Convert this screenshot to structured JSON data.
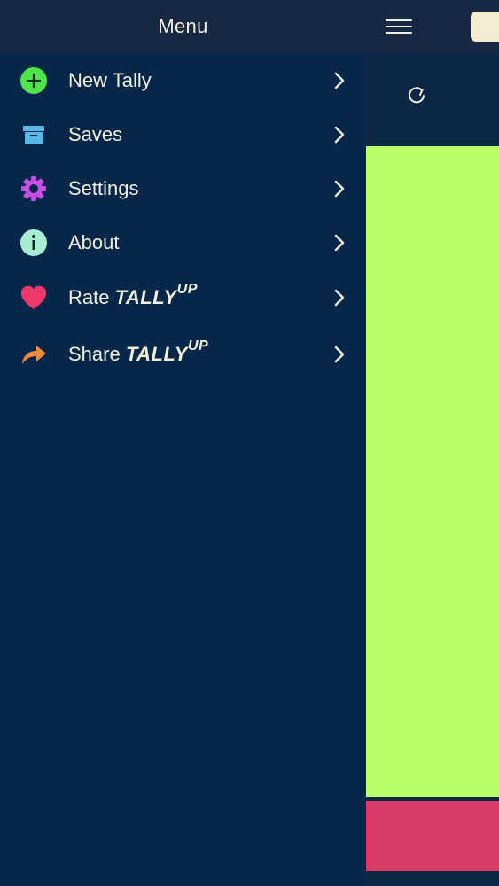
{
  "drawer": {
    "title": "Menu",
    "items": [
      {
        "label": "New Tally",
        "icon": "plus-circle-icon"
      },
      {
        "label": "Saves",
        "icon": "archive-box-icon"
      },
      {
        "label": "Settings",
        "icon": "gear-icon"
      },
      {
        "label": "About",
        "icon": "info-icon"
      },
      {
        "label": "Rate",
        "brand": "TALLY",
        "brand_sup": "UP",
        "icon": "heart-icon"
      },
      {
        "label": "Share",
        "brand": "TALLY",
        "brand_sup": "UP",
        "icon": "share-arrow-icon"
      }
    ]
  },
  "app": {
    "menu_icon": "hamburger-icon",
    "reset_icon": "refresh-icon"
  },
  "colors": {
    "drawer_background": "#06274a",
    "header_background": "#172844",
    "text": "#f2efdc",
    "new_tally_green": "#4ee34a",
    "saves_blue": "#5bb6e8",
    "settings_purple": "#c44ee6",
    "about_mint": "#a9edd0",
    "heart_pink": "#f0386a",
    "share_orange": "#f28a3c",
    "tally_green": "#b8ff6a",
    "tally_red": "#d93d67"
  }
}
